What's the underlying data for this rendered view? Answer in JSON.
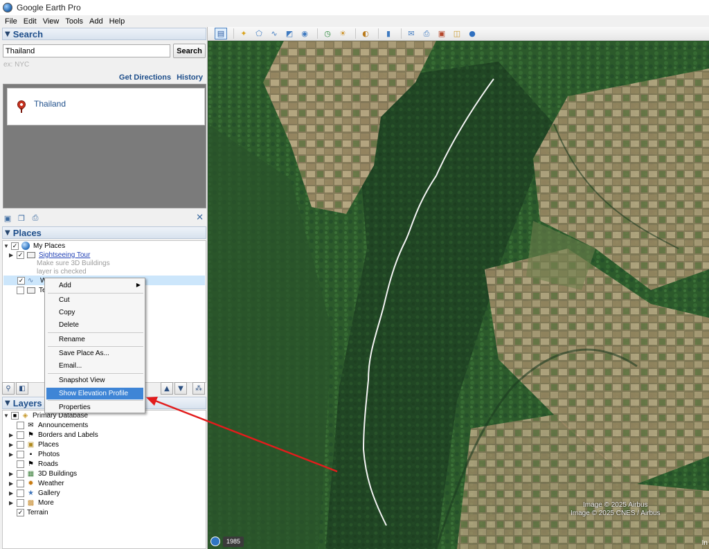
{
  "app": {
    "title": "Google Earth Pro"
  },
  "menu": [
    "File",
    "Edit",
    "View",
    "Tools",
    "Add",
    "Help"
  ],
  "search": {
    "header": "Search",
    "value": "Thailand",
    "button": "Search",
    "hint": "ex: NYC",
    "links": {
      "directions": "Get Directions",
      "history": "History"
    },
    "result": "Thailand"
  },
  "places": {
    "header": "Places",
    "my_places": "My Places",
    "tour": "Sightseeing Tour",
    "tour_note_1": "Make sure 3D Buildings",
    "tour_note_2": "layer is checked",
    "path_name": "WA...",
    "temp": "Temp..."
  },
  "context_menu": {
    "items": [
      "Add",
      "Cut",
      "Copy",
      "Delete",
      "Rename",
      "Save Place As...",
      "Email...",
      "Snapshot View",
      "Show Elevation Profile",
      "Properties"
    ],
    "highlighted": "Show Elevation Profile"
  },
  "layers": {
    "header": "Layers",
    "primary": "Primary Database",
    "items": [
      "Announcements",
      "Borders and Labels",
      "Places",
      "Photos",
      "Roads",
      "3D Buildings",
      "Weather",
      "Gallery",
      "More",
      "Terrain"
    ]
  },
  "map": {
    "attribution_1": "Image © 2025 Airbus",
    "attribution_2": "Image © 2025 CNES / Airbus",
    "year": "1985",
    "corner": "In",
    "colors": {
      "forest": "#2f5a2e",
      "field": "#a58f6c",
      "path": "#f4f4f4",
      "arrow": "#e21c1c"
    }
  }
}
